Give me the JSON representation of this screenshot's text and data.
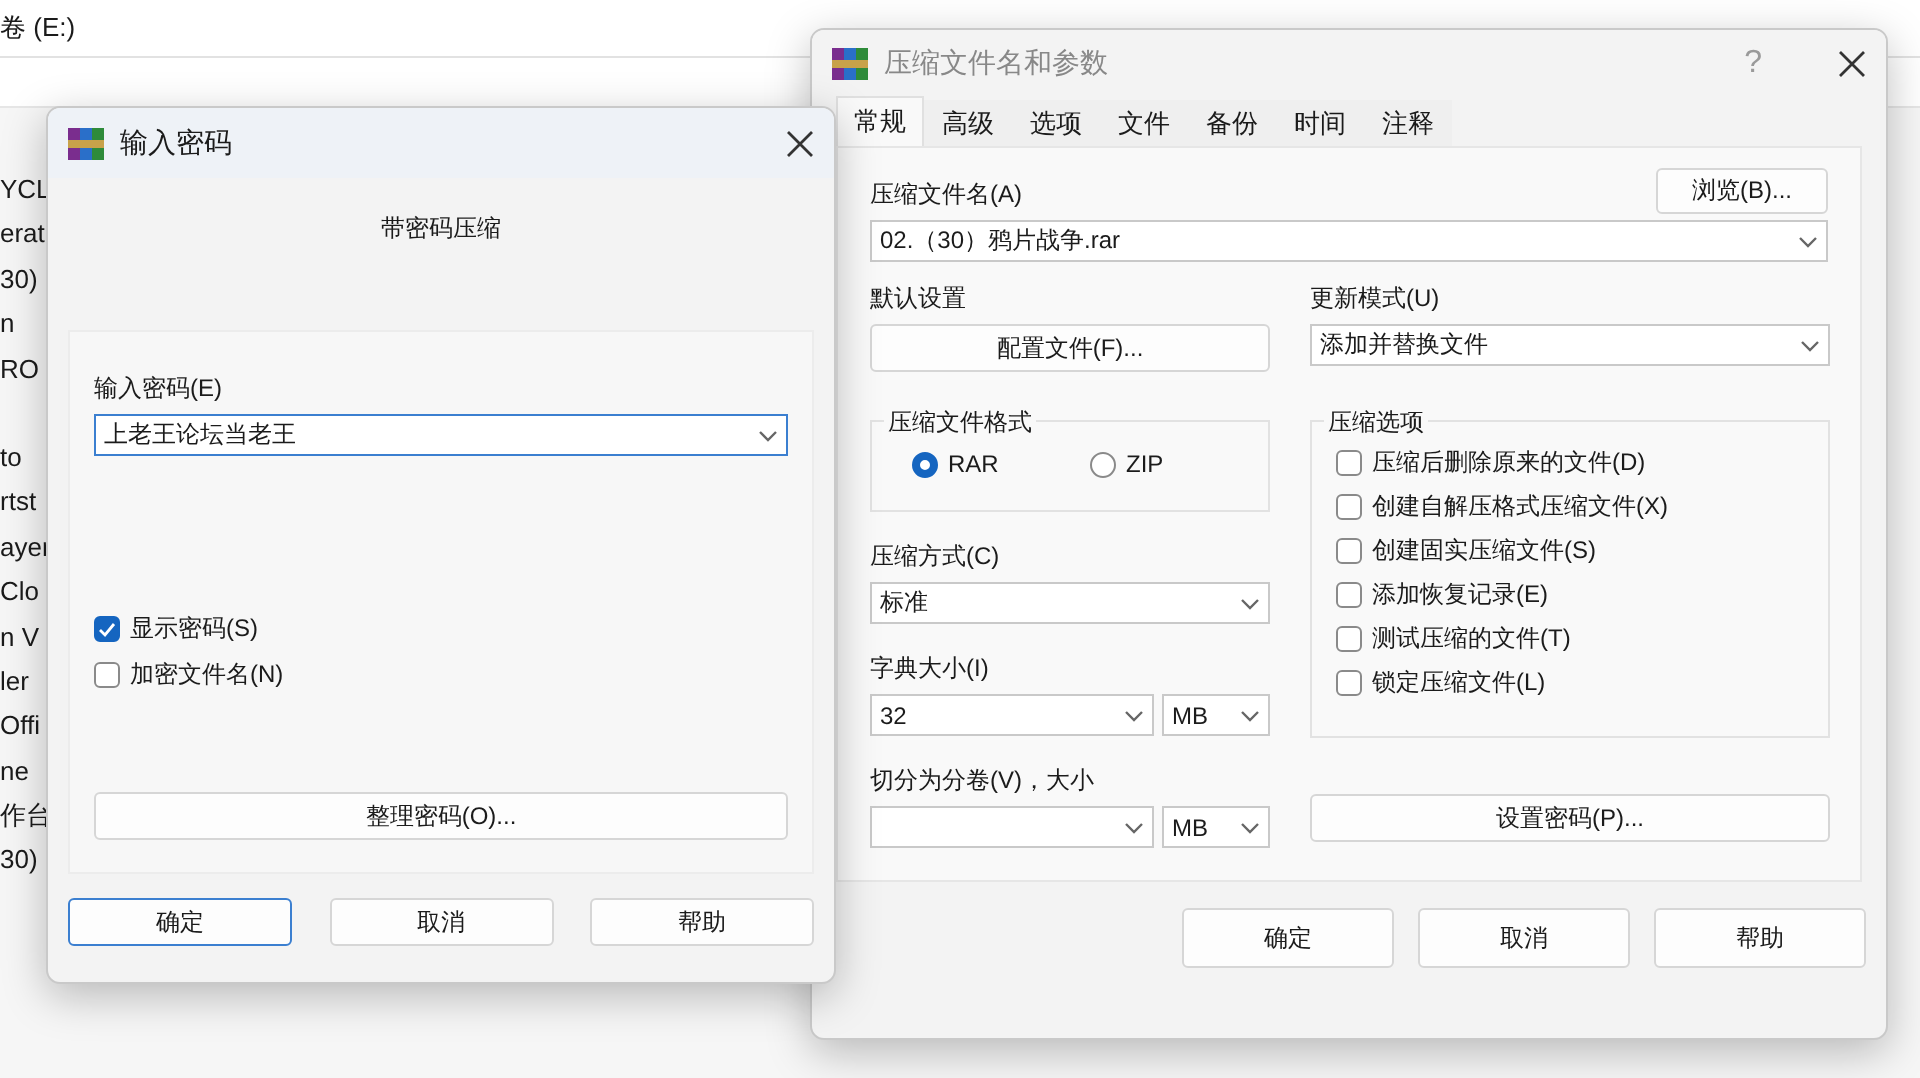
{
  "background_window": {
    "title": "卷 (E:)",
    "item_groups": [
      [
        "YCL",
        "erat",
        "30)",
        "n",
        "RO"
      ],
      [
        "to",
        "rtst",
        "ayer",
        "Clo",
        "n V",
        "ler",
        "Offi",
        "ne",
        "作台",
        "30)"
      ]
    ]
  },
  "archive_dialog": {
    "title": "压缩文件名和参数",
    "help_button": "?",
    "tabs": [
      {
        "label": "常规",
        "selected": true
      },
      {
        "label": "高级",
        "selected": false
      },
      {
        "label": "选项",
        "selected": false
      },
      {
        "label": "文件",
        "selected": false
      },
      {
        "label": "备份",
        "selected": false
      },
      {
        "label": "时间",
        "selected": false
      },
      {
        "label": "注释",
        "selected": false
      }
    ],
    "archive_name": {
      "label": "压缩文件名(A)",
      "value": "02.（30）鸦片战争.rar",
      "browse_button": "浏览(B)..."
    },
    "default_settings": {
      "label": "默认设置",
      "button": "配置文件(F)..."
    },
    "update_mode": {
      "label": "更新模式(U)",
      "value": "添加并替换文件"
    },
    "format": {
      "label": "压缩文件格式",
      "options": [
        {
          "label": "RAR",
          "selected": true
        },
        {
          "label": "ZIP",
          "selected": false
        }
      ]
    },
    "method": {
      "label": "压缩方式(C)",
      "value": "标准"
    },
    "dictionary": {
      "label": "字典大小(I)",
      "value": "32",
      "unit": "MB"
    },
    "split": {
      "label": "切分为分卷(V)，大小",
      "unit": "MB"
    },
    "options": {
      "label": "压缩选项",
      "items": [
        {
          "label": "压缩后删除原来的文件(D)",
          "checked": false
        },
        {
          "label": "创建自解压格式压缩文件(X)",
          "checked": false
        },
        {
          "label": "创建固实压缩文件(S)",
          "checked": false
        },
        {
          "label": "添加恢复记录(E)",
          "checked": false
        },
        {
          "label": "测试压缩的文件(T)",
          "checked": false
        },
        {
          "label": "锁定压缩文件(L)",
          "checked": false
        }
      ]
    },
    "password_button": "设置密码(P)...",
    "buttons": [
      "确定",
      "取消",
      "帮助"
    ]
  },
  "password_dialog": {
    "title": "输入密码",
    "heading": "带密码压缩",
    "field": {
      "label": "输入密码(E)",
      "value": "上老王论坛当老王"
    },
    "checkboxes": [
      {
        "label": "显示密码(S)",
        "checked": true
      },
      {
        "label": "加密文件名(N)",
        "checked": false
      }
    ],
    "organize_button": "整理密码(O)...",
    "buttons": [
      {
        "label": "确定",
        "focused": true
      },
      {
        "label": "取消",
        "focused": false
      },
      {
        "label": "帮助",
        "focused": false
      }
    ]
  }
}
